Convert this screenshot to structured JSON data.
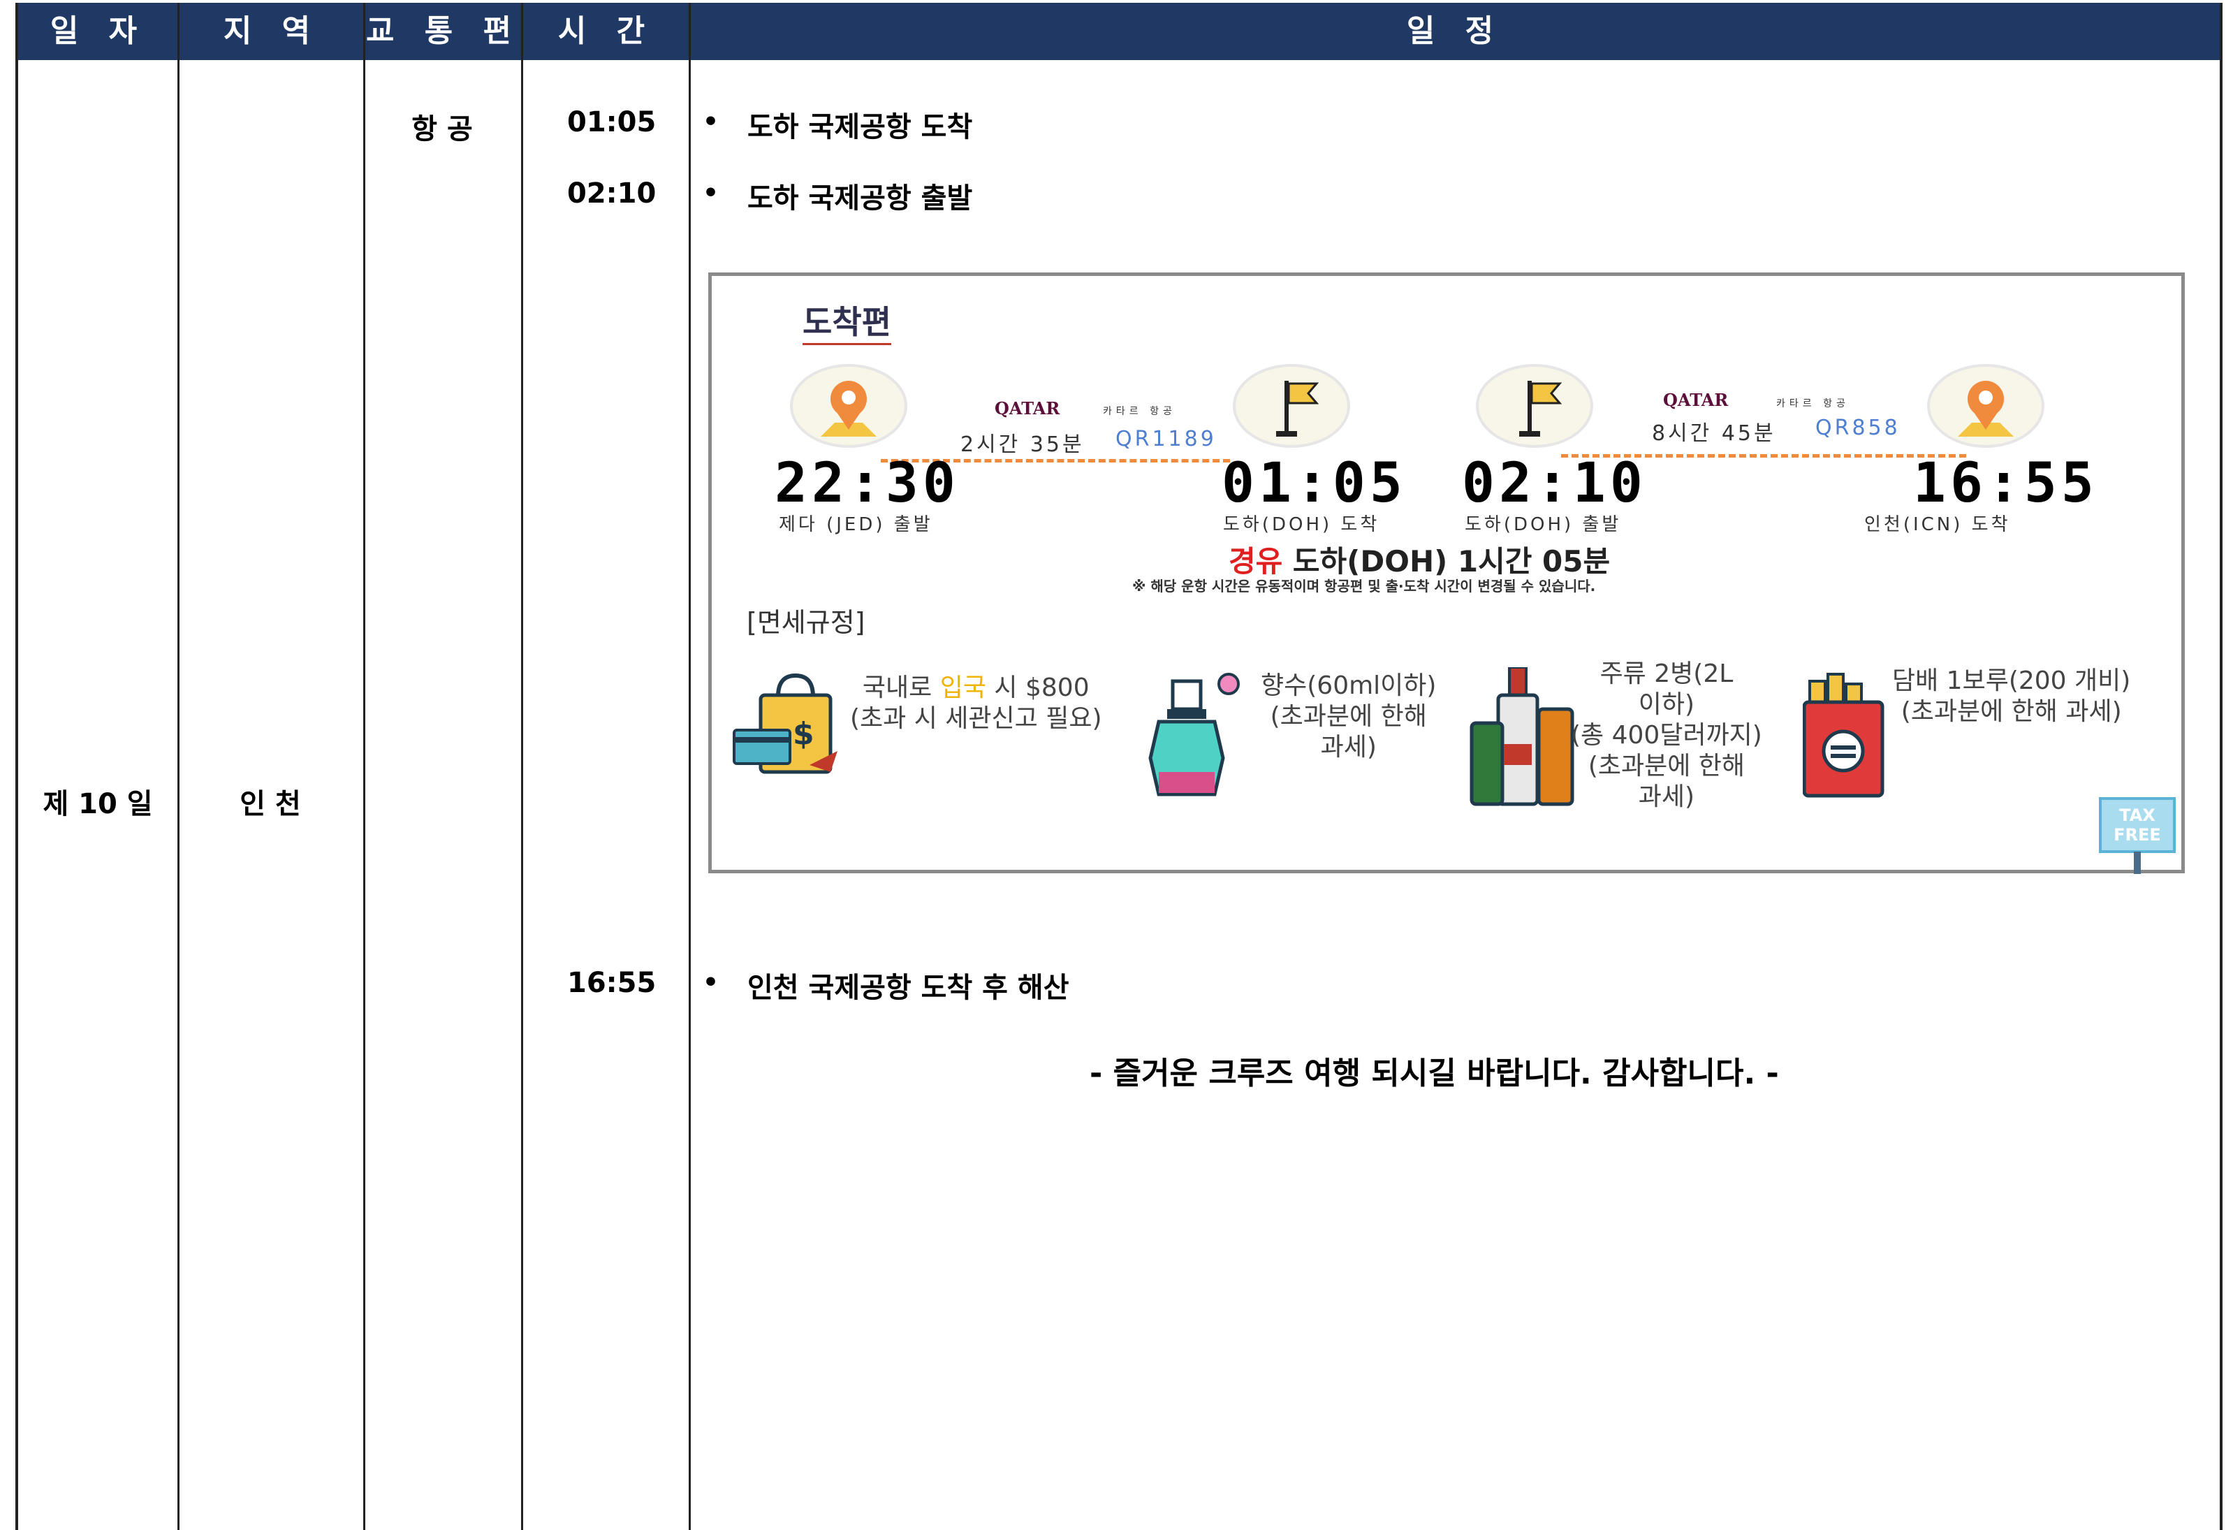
{
  "header": {
    "col_date": "일 자",
    "col_region": "지 역",
    "col_transport": "교 통 편",
    "col_time": "시 간",
    "col_schedule": "일 정"
  },
  "row": {
    "day": "제 10 일",
    "region": "인 천",
    "transport": "항 공",
    "entries": [
      {
        "time": "01:05",
        "text": "도하 국제공항 도착"
      },
      {
        "time": "02:10",
        "text": "도하 국제공항 출발"
      },
      {
        "time": "16:55",
        "text": "인천 국제공항 도착 후 해산"
      }
    ],
    "bullet": "•",
    "closing": "- 즐거운 크루즈 여행 되시길 바랍니다. 감사합니다. -"
  },
  "infographic": {
    "title": "도착편",
    "leg1": {
      "airline": "QATAR",
      "airline_kr": "카타르 항공",
      "duration": "2시간 35분",
      "flight": "QR1189",
      "dep_time": "22:30",
      "dep_label": "제다 (JED) 출발",
      "arr_time": "01:05",
      "arr_label": "도하(DOH) 도착"
    },
    "leg2": {
      "airline": "QATAR",
      "airline_kr": "카타르 항공",
      "duration": "8시간 45분",
      "flight": "QR858",
      "dep_time": "02:10",
      "dep_label": "도하(DOH) 출발",
      "arr_time": "16:55",
      "arr_label": "인천(ICN) 도착"
    },
    "layover_prefix": "경유",
    "layover_text": "도하(DOH) 1시간 05분",
    "notice": "※ 해당 운항 시간은 유동적이며 항공편 및 출·도착 시간이 변경될 수 있습니다.",
    "duty_title": "[면세규정]",
    "duty_items": [
      {
        "icon": "shopping-bag-icon",
        "pre": "국내로 ",
        "highlight": "입국",
        "post": " 시 $800",
        "line2": "(초과 시 세관신고 필요)"
      },
      {
        "icon": "perfume-icon",
        "line1": "향수(60ml이하)",
        "line2": "(초과분에 한해",
        "line3": "과세)"
      },
      {
        "icon": "liquor-bottles-icon",
        "line1": "주류 2병(2L",
        "line2": "이하)",
        "line3": "(총 400달러까지)",
        "line4": "(초과분에 한해",
        "line5": "과세)"
      },
      {
        "icon": "cigarette-pack-icon",
        "line1": "담배 1보루(200 개비)",
        "line2": "(초과분에 한해 과세)"
      }
    ],
    "tax_free_line1": "TAX",
    "tax_free_line2": "FREE",
    "colors": {
      "header_bg": "#1f3864",
      "dash": "#f08a3c",
      "flight_no": "#4f7fd1",
      "layover_red": "#e02020",
      "highlight_yellow": "#f0b400"
    }
  }
}
